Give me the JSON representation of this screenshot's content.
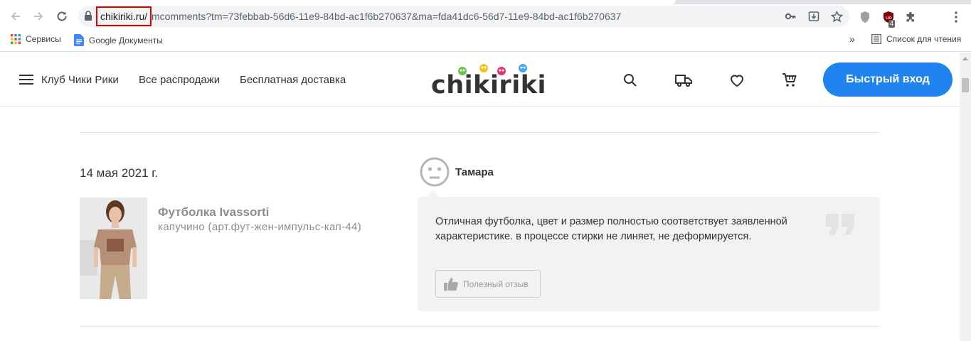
{
  "browser": {
    "url_host": "chikiriki.ru/",
    "url_rest": "mcomments?tm=73febbab-56d6-11e9-84bd-ac1f6b270637&ma=fda41dc6-56d7-11e9-84bd-ac1f6b270637",
    "extension_badge": "4",
    "bookmarks": {
      "services": "Сервисы",
      "google_docs": "Google Документы",
      "reading_list": "Список для чтения",
      "more": "»"
    }
  },
  "header": {
    "nav": [
      "Клуб Чики Рики",
      "Все распродажи",
      "Бесплатная доставка"
    ],
    "logo_text": "chikiriki",
    "login_button": "Быстрый вход"
  },
  "review": {
    "date": "14 мая 2021 г.",
    "author": "Тамара",
    "product_name": "Футболка Ivassorti",
    "product_variant": "капучино (арт.фут-жен-импульс-кап-44)",
    "text": "Отличная футболка, цвет и размер полностью соответствует заявленной характеристике. в процессе стирки не линяет, не деформируется.",
    "helpful_button": "Полезный отзыв"
  },
  "colors": {
    "accent": "#1f84f0",
    "highlight_box": "#e00000",
    "bubble_bg": "#f2f2f2"
  }
}
